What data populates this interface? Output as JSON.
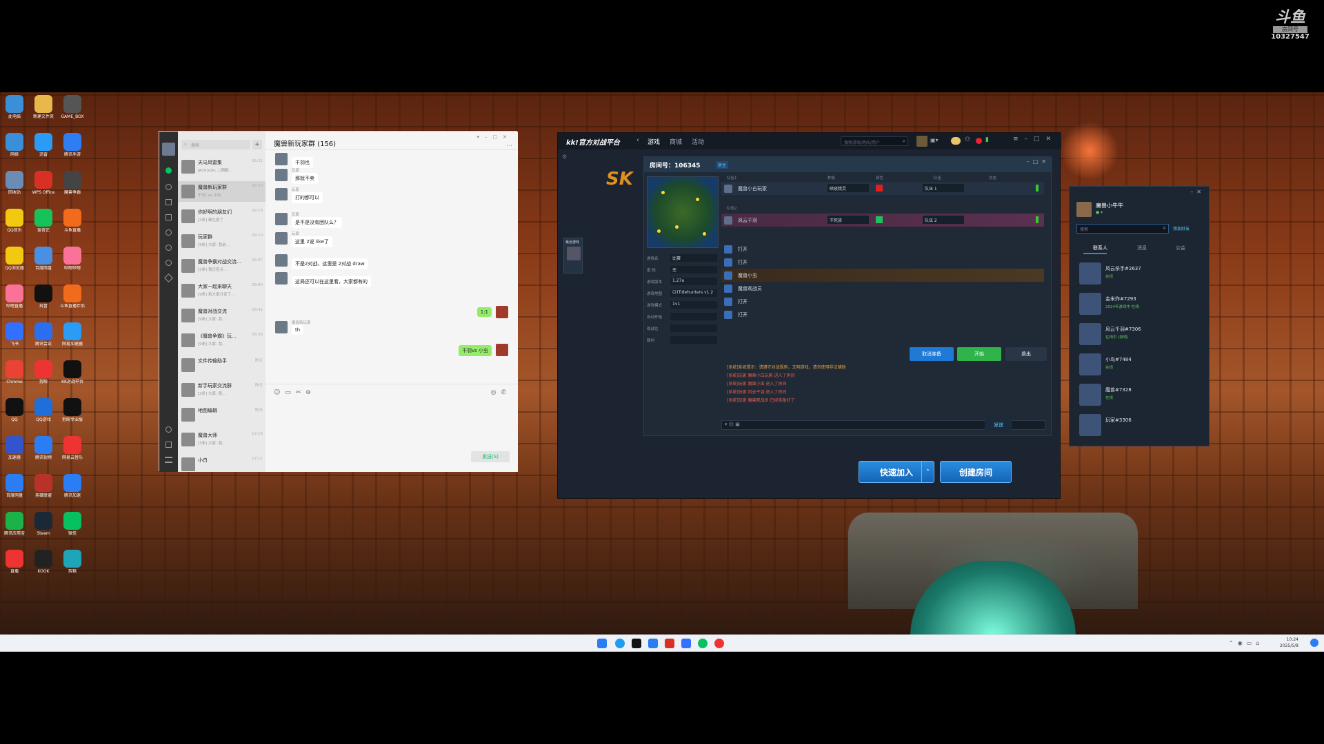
{
  "watermark": {
    "logo": "斗鱼",
    "sub": "房间号",
    "room": "10327547"
  },
  "desktop_icons": [
    {
      "label": "此电脑",
      "color": "#3a8fd8"
    },
    {
      "label": "新建文件夹",
      "color": "#e8b84a"
    },
    {
      "label": "GAME_BOX",
      "color": "#555"
    },
    {
      "label": "网络",
      "color": "#3a8fd8"
    },
    {
      "label": "迅雷",
      "color": "#2a9cf5"
    },
    {
      "label": "腾讯手游",
      "color": "#2f7df2"
    },
    {
      "label": "回收站",
      "color": "#6b8db5"
    },
    {
      "label": "WPS Office",
      "color": "#d93025"
    },
    {
      "label": "魔兽争霸",
      "color": "#444"
    },
    {
      "label": "QQ音乐",
      "color": "#f2c811"
    },
    {
      "label": "爱奇艺",
      "color": "#16c35a"
    },
    {
      "label": "斗鱼直播",
      "color": "#f26a1b"
    },
    {
      "label": "QQ浏览器",
      "color": "#f2c811"
    },
    {
      "label": "百度网盘",
      "color": "#4a90e2"
    },
    {
      "label": "哔哩哔哩",
      "color": "#fb7299"
    },
    {
      "label": "哔哩直播",
      "color": "#fb7299"
    },
    {
      "label": "抖音",
      "color": "#111"
    },
    {
      "label": "斗鱼直播伴侣",
      "color": "#f26a1b"
    },
    {
      "label": "飞书",
      "color": "#3370ff"
    },
    {
      "label": "腾讯会议",
      "color": "#2a6ff0"
    },
    {
      "label": "网易加速器",
      "color": "#2a9cf5"
    },
    {
      "label": "Chrome",
      "color": "#ea4335"
    },
    {
      "label": "剪映",
      "color": "#e33"
    },
    {
      "label": "KK对战平台",
      "color": "#111"
    },
    {
      "label": "QQ",
      "color": "#111"
    },
    {
      "label": "QQ游戏",
      "color": "#1e6fd9"
    },
    {
      "label": "剪映专业版",
      "color": "#111"
    },
    {
      "label": "加速器",
      "color": "#3355cc"
    },
    {
      "label": "腾讯视频",
      "color": "#2a7df2"
    },
    {
      "label": "网易云音乐",
      "color": "#e33"
    },
    {
      "label": "百度网盘",
      "color": "#2a7df2"
    },
    {
      "label": "英雄联盟",
      "color": "#b8322a"
    },
    {
      "label": "腾讯加速",
      "color": "#2a7df2"
    },
    {
      "label": "腾讯应用宝",
      "color": "#19b34a"
    },
    {
      "label": "Steam",
      "color": "#1b2838"
    },
    {
      "label": "微信",
      "color": "#07c160"
    },
    {
      "label": "直播",
      "color": "#e33"
    },
    {
      "label": "KOOK",
      "color": "#222"
    },
    {
      "label": "剪辑",
      "color": "#1ea6b8"
    }
  ],
  "wechat": {
    "search_placeholder": "搜索",
    "chat_title": "魔兽新玩家群 (156)",
    "conversations": [
      {
        "name": "天马风雷集",
        "preview": "JACKSON: 二期都…",
        "time": "09:21"
      },
      {
        "name": "魔兽新玩家群",
        "preview": "干羽: vs 小虫",
        "time": "09:20"
      },
      {
        "name": "你好啊的朋友们",
        "preview": "[2条] 都在那了",
        "time": "09:18"
      },
      {
        "name": "玩家群",
        "preview": "[9条] 大家: 我是…",
        "time": "09:10"
      },
      {
        "name": "魔兽争霸对战交流…",
        "preview": "[2条] 我还差点…",
        "time": "09:07"
      },
      {
        "name": "大家一起来聊天",
        "preview": "[9条] 和大家分享了…",
        "time": "09:00"
      },
      {
        "name": "魔兽对战交流",
        "preview": "[9条] 大家: 我…",
        "time": "08:41"
      },
      {
        "name": "《魔兽争霸》玩…",
        "preview": "[9条] 大家: 我…",
        "time": "08:38"
      },
      {
        "name": "文件传输助手",
        "preview": "",
        "time": "昨天"
      },
      {
        "name": "新手玩家交流群",
        "preview": "[2条] 大家: 我…",
        "time": "昨天"
      },
      {
        "name": "地图编辑",
        "preview": "",
        "time": "昨天"
      },
      {
        "name": "魔兽大师",
        "preview": "[3条] 大家: 我…",
        "time": "12:18"
      },
      {
        "name": "小白",
        "preview": "",
        "time": "12:11"
      }
    ],
    "messages": [
      {
        "side": "in",
        "text": "干羽也"
      },
      {
        "side": "in",
        "name": "玩家",
        "text": "那就不卖"
      },
      {
        "side": "in",
        "name": "玩家",
        "text": "打的都可以"
      },
      {
        "side": "in",
        "name": "玩家",
        "text": "是不是没有团队么？"
      },
      {
        "side": "in",
        "name": "玩家",
        "text": "这里 2说 like了"
      },
      {
        "side": "in",
        "name": "",
        "text": "不是2对战，这里是 2对战 draw"
      },
      {
        "side": "in",
        "name": "",
        "text": "这局还可以在这里看，大家都有的"
      },
      {
        "side": "out",
        "text": "1:1"
      },
      {
        "side": "in",
        "name": "魔兽新玩家",
        "text": "th"
      },
      {
        "side": "out",
        "text": "干羽vs 小虫"
      }
    ],
    "send_label": "发送(S)"
  },
  "kk": {
    "brand": "kk!官方对战平台",
    "nav": [
      "游戏",
      "商城",
      "活动"
    ],
    "search_placeholder": "搜索游戏/房间/用户",
    "room_label": "房间号：106345",
    "room_tag": "房主",
    "room_settings": [
      {
        "key": "游戏名",
        "value": "比赛"
      },
      {
        "key": "密 码",
        "value": "无"
      },
      {
        "key": "游戏版本",
        "value": "1.27a"
      },
      {
        "key": "游戏地图",
        "value": "(2)Tidehunters v1.2"
      },
      {
        "key": "游戏模式",
        "value": "1v1"
      },
      {
        "key": "自动开始",
        "value": ""
      },
      {
        "key": "观战位",
        "value": ""
      },
      {
        "key": "裁判",
        "value": ""
      }
    ],
    "col_headers": [
      "队伍1",
      "种族",
      "颜色",
      "队伍",
      "状态"
    ],
    "slots": [
      {
        "team": "队伍1",
        "player": "魔兽小白玩家",
        "race": "暗夜精灵",
        "color_hex": "#e02020",
        "team_label": "队伍 1",
        "ready": true
      },
      {
        "team": "队伍2",
        "player": "风云干羽",
        "race": "不死族",
        "color_hex": "#20c060",
        "team_label": "队伍 2",
        "ready": true
      }
    ],
    "observers": [
      {
        "name": "打开"
      },
      {
        "name": "打开"
      },
      {
        "name": "魔兽小虫"
      },
      {
        "name": "魔兽观战员"
      },
      {
        "name": "打开"
      },
      {
        "name": "打开"
      }
    ],
    "buttons": {
      "cancel_ready": "取消准备",
      "start": "开始",
      "quit": "退出"
    },
    "system_messages": [
      "[系统]系统提示：请遵守对战规则，文明游戏，请勿使用非法辅助",
      "[系统]玩家 魔兽小白玩家 进入了房间",
      "[系统]玩家 魔兽小虫 进入了房间",
      "[系统]玩家 风云干羽 进入了房间",
      "[系统]玩家 魔兽观战员 已经准备好了"
    ],
    "chat_placeholder": "",
    "send_label": "发送",
    "quick_join": "快速加入",
    "create_room": "创建房间",
    "sidebar_label": "最近游戏"
  },
  "friends": {
    "user_name": "魔兽小牛牛",
    "search_placeholder": "搜索",
    "add_friend": "添加好友",
    "tabs": [
      "联系人",
      "消息",
      "公会"
    ],
    "list": [
      {
        "name": "风云杀手#2637",
        "status": "在线"
      },
      {
        "name": "金米炸#7293",
        "status": "2024年游戏中 在线"
      },
      {
        "name": "风云千羽#7306",
        "status": "在线中 (游戏)"
      },
      {
        "name": "小鸟#7484",
        "status": "在线"
      },
      {
        "name": "魔兽#7328",
        "status": "在线"
      },
      {
        "name": "玩家#3306",
        "status": ""
      }
    ]
  },
  "taskbar": {
    "time": "10:24",
    "date": "2025/5/8"
  }
}
